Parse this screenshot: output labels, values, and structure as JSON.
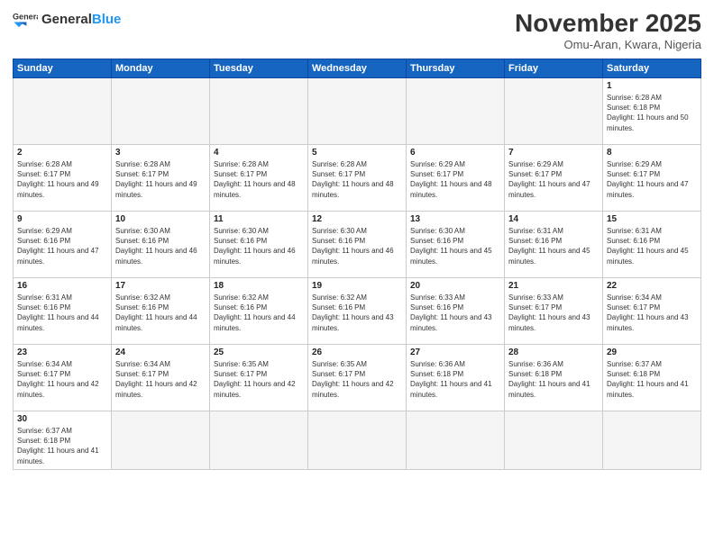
{
  "logo": {
    "text_general": "General",
    "text_blue": "Blue"
  },
  "title": "November 2025",
  "location": "Omu-Aran, Kwara, Nigeria",
  "headers": [
    "Sunday",
    "Monday",
    "Tuesday",
    "Wednesday",
    "Thursday",
    "Friday",
    "Saturday"
  ],
  "days": [
    {
      "num": "",
      "sunrise": "",
      "sunset": "",
      "daylight": "",
      "empty": true
    },
    {
      "num": "",
      "sunrise": "",
      "sunset": "",
      "daylight": "",
      "empty": true
    },
    {
      "num": "",
      "sunrise": "",
      "sunset": "",
      "daylight": "",
      "empty": true
    },
    {
      "num": "",
      "sunrise": "",
      "sunset": "",
      "daylight": "",
      "empty": true
    },
    {
      "num": "",
      "sunrise": "",
      "sunset": "",
      "daylight": "",
      "empty": true
    },
    {
      "num": "",
      "sunrise": "",
      "sunset": "",
      "daylight": "",
      "empty": true
    },
    {
      "num": "1",
      "sunrise": "Sunrise: 6:28 AM",
      "sunset": "Sunset: 6:18 PM",
      "daylight": "Daylight: 11 hours and 50 minutes.",
      "empty": false
    },
    {
      "num": "2",
      "sunrise": "Sunrise: 6:28 AM",
      "sunset": "Sunset: 6:17 PM",
      "daylight": "Daylight: 11 hours and 49 minutes.",
      "empty": false
    },
    {
      "num": "3",
      "sunrise": "Sunrise: 6:28 AM",
      "sunset": "Sunset: 6:17 PM",
      "daylight": "Daylight: 11 hours and 49 minutes.",
      "empty": false
    },
    {
      "num": "4",
      "sunrise": "Sunrise: 6:28 AM",
      "sunset": "Sunset: 6:17 PM",
      "daylight": "Daylight: 11 hours and 48 minutes.",
      "empty": false
    },
    {
      "num": "5",
      "sunrise": "Sunrise: 6:28 AM",
      "sunset": "Sunset: 6:17 PM",
      "daylight": "Daylight: 11 hours and 48 minutes.",
      "empty": false
    },
    {
      "num": "6",
      "sunrise": "Sunrise: 6:29 AM",
      "sunset": "Sunset: 6:17 PM",
      "daylight": "Daylight: 11 hours and 48 minutes.",
      "empty": false
    },
    {
      "num": "7",
      "sunrise": "Sunrise: 6:29 AM",
      "sunset": "Sunset: 6:17 PM",
      "daylight": "Daylight: 11 hours and 47 minutes.",
      "empty": false
    },
    {
      "num": "8",
      "sunrise": "Sunrise: 6:29 AM",
      "sunset": "Sunset: 6:17 PM",
      "daylight": "Daylight: 11 hours and 47 minutes.",
      "empty": false
    },
    {
      "num": "9",
      "sunrise": "Sunrise: 6:29 AM",
      "sunset": "Sunset: 6:16 PM",
      "daylight": "Daylight: 11 hours and 47 minutes.",
      "empty": false
    },
    {
      "num": "10",
      "sunrise": "Sunrise: 6:30 AM",
      "sunset": "Sunset: 6:16 PM",
      "daylight": "Daylight: 11 hours and 46 minutes.",
      "empty": false
    },
    {
      "num": "11",
      "sunrise": "Sunrise: 6:30 AM",
      "sunset": "Sunset: 6:16 PM",
      "daylight": "Daylight: 11 hours and 46 minutes.",
      "empty": false
    },
    {
      "num": "12",
      "sunrise": "Sunrise: 6:30 AM",
      "sunset": "Sunset: 6:16 PM",
      "daylight": "Daylight: 11 hours and 46 minutes.",
      "empty": false
    },
    {
      "num": "13",
      "sunrise": "Sunrise: 6:30 AM",
      "sunset": "Sunset: 6:16 PM",
      "daylight": "Daylight: 11 hours and 45 minutes.",
      "empty": false
    },
    {
      "num": "14",
      "sunrise": "Sunrise: 6:31 AM",
      "sunset": "Sunset: 6:16 PM",
      "daylight": "Daylight: 11 hours and 45 minutes.",
      "empty": false
    },
    {
      "num": "15",
      "sunrise": "Sunrise: 6:31 AM",
      "sunset": "Sunset: 6:16 PM",
      "daylight": "Daylight: 11 hours and 45 minutes.",
      "empty": false
    },
    {
      "num": "16",
      "sunrise": "Sunrise: 6:31 AM",
      "sunset": "Sunset: 6:16 PM",
      "daylight": "Daylight: 11 hours and 44 minutes.",
      "empty": false
    },
    {
      "num": "17",
      "sunrise": "Sunrise: 6:32 AM",
      "sunset": "Sunset: 6:16 PM",
      "daylight": "Daylight: 11 hours and 44 minutes.",
      "empty": false
    },
    {
      "num": "18",
      "sunrise": "Sunrise: 6:32 AM",
      "sunset": "Sunset: 6:16 PM",
      "daylight": "Daylight: 11 hours and 44 minutes.",
      "empty": false
    },
    {
      "num": "19",
      "sunrise": "Sunrise: 6:32 AM",
      "sunset": "Sunset: 6:16 PM",
      "daylight": "Daylight: 11 hours and 43 minutes.",
      "empty": false
    },
    {
      "num": "20",
      "sunrise": "Sunrise: 6:33 AM",
      "sunset": "Sunset: 6:16 PM",
      "daylight": "Daylight: 11 hours and 43 minutes.",
      "empty": false
    },
    {
      "num": "21",
      "sunrise": "Sunrise: 6:33 AM",
      "sunset": "Sunset: 6:17 PM",
      "daylight": "Daylight: 11 hours and 43 minutes.",
      "empty": false
    },
    {
      "num": "22",
      "sunrise": "Sunrise: 6:34 AM",
      "sunset": "Sunset: 6:17 PM",
      "daylight": "Daylight: 11 hours and 43 minutes.",
      "empty": false
    },
    {
      "num": "23",
      "sunrise": "Sunrise: 6:34 AM",
      "sunset": "Sunset: 6:17 PM",
      "daylight": "Daylight: 11 hours and 42 minutes.",
      "empty": false
    },
    {
      "num": "24",
      "sunrise": "Sunrise: 6:34 AM",
      "sunset": "Sunset: 6:17 PM",
      "daylight": "Daylight: 11 hours and 42 minutes.",
      "empty": false
    },
    {
      "num": "25",
      "sunrise": "Sunrise: 6:35 AM",
      "sunset": "Sunset: 6:17 PM",
      "daylight": "Daylight: 11 hours and 42 minutes.",
      "empty": false
    },
    {
      "num": "26",
      "sunrise": "Sunrise: 6:35 AM",
      "sunset": "Sunset: 6:17 PM",
      "daylight": "Daylight: 11 hours and 42 minutes.",
      "empty": false
    },
    {
      "num": "27",
      "sunrise": "Sunrise: 6:36 AM",
      "sunset": "Sunset: 6:18 PM",
      "daylight": "Daylight: 11 hours and 41 minutes.",
      "empty": false
    },
    {
      "num": "28",
      "sunrise": "Sunrise: 6:36 AM",
      "sunset": "Sunset: 6:18 PM",
      "daylight": "Daylight: 11 hours and 41 minutes.",
      "empty": false
    },
    {
      "num": "29",
      "sunrise": "Sunrise: 6:37 AM",
      "sunset": "Sunset: 6:18 PM",
      "daylight": "Daylight: 11 hours and 41 minutes.",
      "empty": false
    },
    {
      "num": "30",
      "sunrise": "Sunrise: 6:37 AM",
      "sunset": "Sunset: 6:18 PM",
      "daylight": "Daylight: 11 hours and 41 minutes.",
      "empty": false
    }
  ]
}
